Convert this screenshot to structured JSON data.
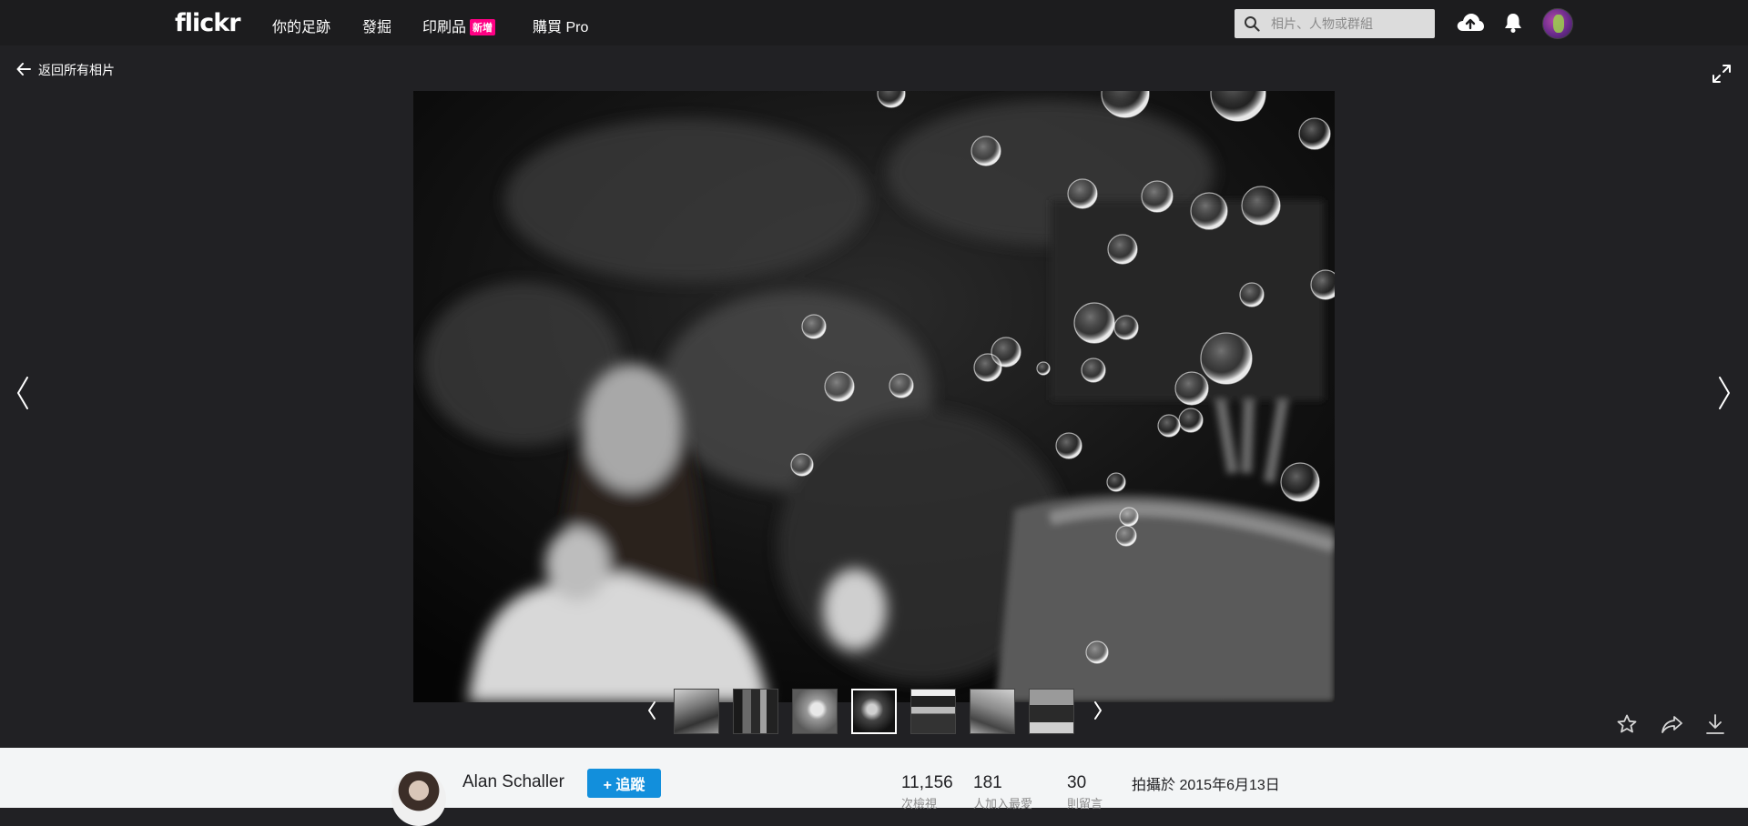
{
  "header": {
    "logo": "flickr",
    "nav": {
      "you": "你的足跡",
      "explore": "發掘",
      "prints": "印刷品",
      "prints_badge": "新增",
      "pro": "購買 Pro"
    },
    "search_placeholder": "相片、人物或群組",
    "icons": [
      "search-icon",
      "upload-cloud-icon",
      "notification-bell-icon",
      "avatar"
    ]
  },
  "stage": {
    "back_label": "返回所有相片",
    "icons": [
      "arrow-left-icon",
      "expand-icon",
      "chevron-left-icon",
      "chevron-right-icon"
    ]
  },
  "filmstrip": {
    "thumb_count": 7,
    "active_index": 3,
    "icons": [
      "chevron-left-icon",
      "chevron-right-icon"
    ]
  },
  "actions": {
    "icons": [
      "star-icon",
      "share-icon",
      "download-icon"
    ]
  },
  "owner": {
    "name": "Alan Schaller",
    "follow_label": "追蹤"
  },
  "stats": {
    "views": {
      "value": "11,156",
      "label": "次檢視"
    },
    "faves": {
      "value": "181",
      "label": "人加入最愛"
    },
    "comments": {
      "value": "30",
      "label": "則留言"
    }
  },
  "taken": {
    "label": "拍攝於",
    "date": "2015年6月13日"
  },
  "colors": {
    "page_bg": "#212124",
    "nav_bg": "#1c1c1e",
    "accent_pink": "#ff0084",
    "follow_blue": "#128fdc",
    "info_bg": "#f3f5f6"
  }
}
